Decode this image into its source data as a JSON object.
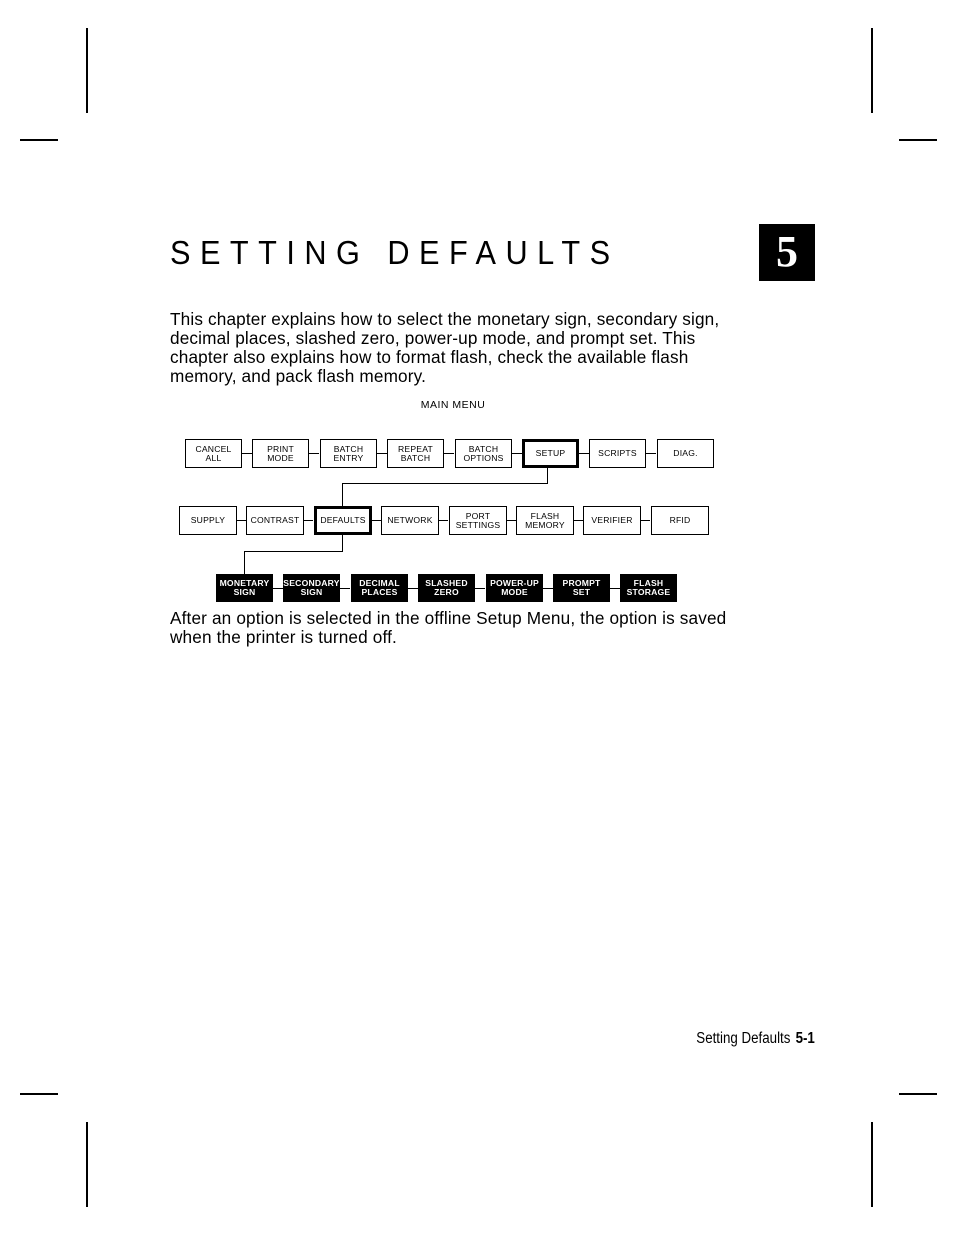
{
  "page": {
    "title": "SETTING DEFAULTS",
    "chapter_tab": "5",
    "intro": "This chapter explains how to select the monetary sign, secondary sign, decimal places, slashed zero, power-up mode, and prompt set.  This chapter also explains how to format flash, check the available flash memory, and pack flash memory.",
    "after_text": "After an option is selected in the offline Setup Menu, the option is saved when the printer is turned off.",
    "footer": {
      "section": "Setting Defaults",
      "page_number": "5-1"
    }
  },
  "diagram": {
    "label": "MAIN MENU",
    "main_menu": [
      {
        "label": "CANCEL\nALL",
        "selected": false
      },
      {
        "label": "PRINT\nMODE",
        "selected": false
      },
      {
        "label": "BATCH\nENTRY",
        "selected": false
      },
      {
        "label": "REPEAT\nBATCH",
        "selected": false
      },
      {
        "label": "BATCH\nOPTIONS",
        "selected": false
      },
      {
        "label": "SETUP",
        "selected": true
      },
      {
        "label": "SCRIPTS",
        "selected": false
      },
      {
        "label": "DIAG.",
        "selected": false
      }
    ],
    "setup_menu": [
      {
        "label": "SUPPLY",
        "selected": false
      },
      {
        "label": "CONTRAST",
        "selected": false
      },
      {
        "label": "DEFAULTS",
        "selected": true
      },
      {
        "label": "NETWORK",
        "selected": false
      },
      {
        "label": "PORT\nSETTINGS",
        "selected": false
      },
      {
        "label": "FLASH\nMEMORY",
        "selected": false
      },
      {
        "label": "VERIFIER",
        "selected": false
      },
      {
        "label": "RFID",
        "selected": false
      }
    ],
    "defaults_menu": [
      {
        "label": "MONETARY\nSIGN"
      },
      {
        "label": "SECONDARY\nSIGN"
      },
      {
        "label": "DECIMAL\nPLACES"
      },
      {
        "label": "SLASHED\nZERO"
      },
      {
        "label": "POWER-UP\nMODE"
      },
      {
        "label": "PROMPT\nSET"
      },
      {
        "label": "FLASH\nSTORAGE"
      }
    ]
  }
}
